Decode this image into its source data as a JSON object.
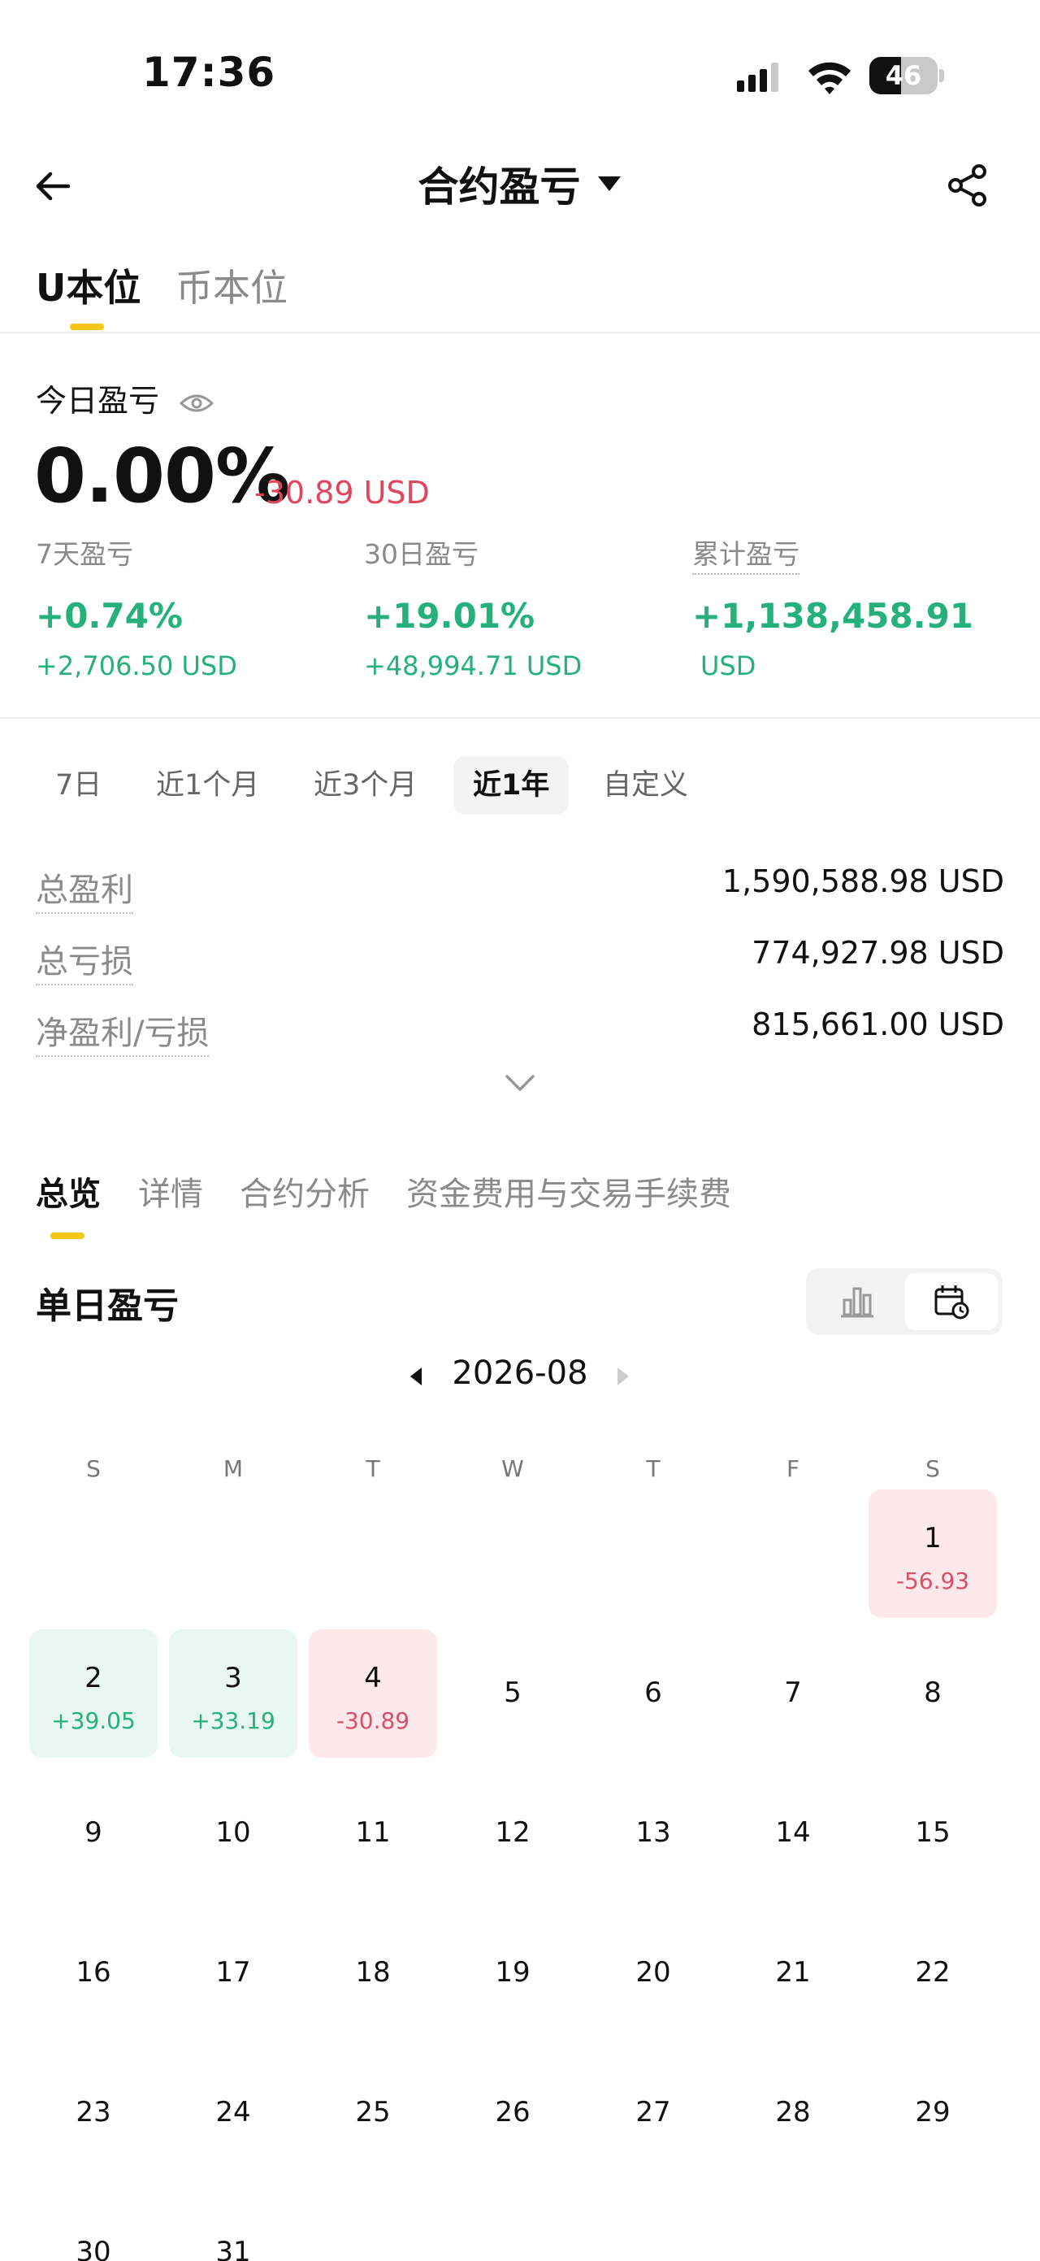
{
  "status_bar": {
    "time": "17:36",
    "battery": "46",
    "battery_level": 0.46
  },
  "header": {
    "title": "合约盈亏",
    "back_icon": "arrow-left-icon",
    "share_icon": "share-icon"
  },
  "unit_tabs": [
    {
      "label": "U本位",
      "active": true
    },
    {
      "label": "币本位",
      "active": false
    }
  ],
  "today": {
    "label": "今日盈亏",
    "percent": "0.00%",
    "usd": "-30.89 USD"
  },
  "stats": [
    {
      "label": "7天盈亏",
      "pct": "+0.74%",
      "usd": "+2,706.50 USD"
    },
    {
      "label": "30日盈亏",
      "pct": "+19.01%",
      "usd": "+48,994.71 USD"
    },
    {
      "label": "累计盈亏",
      "pct": "+1,138,458.91",
      "usd": "USD"
    }
  ],
  "ranges": [
    {
      "label": "7日",
      "active": false
    },
    {
      "label": "近1个月",
      "active": false
    },
    {
      "label": "近3个月",
      "active": false
    },
    {
      "label": "近1年",
      "active": true
    },
    {
      "label": "自定义",
      "active": false
    }
  ],
  "totals": [
    {
      "label": "总盈利",
      "value": "1,590,588.98 USD"
    },
    {
      "label": "总亏损",
      "value": "774,927.98 USD"
    },
    {
      "label": "净盈利/亏损",
      "value": "815,661.00 USD"
    }
  ],
  "section_tabs": [
    {
      "label": "总览",
      "active": true
    },
    {
      "label": "详情",
      "active": false
    },
    {
      "label": "合约分析",
      "active": false
    },
    {
      "label": "资金费用与交易手续费",
      "active": false
    }
  ],
  "daily": {
    "title": "单日盈亏",
    "month": "2026-08",
    "weekdays": [
      "S",
      "M",
      "T",
      "W",
      "T",
      "F",
      "S"
    ],
    "days": [
      {
        "d": "1",
        "pnl": "-56.93",
        "type": "loss"
      },
      {
        "d": "2",
        "pnl": "+39.05",
        "type": "profit"
      },
      {
        "d": "3",
        "pnl": "+33.19",
        "type": "profit"
      },
      {
        "d": "4",
        "pnl": "-30.89",
        "type": "loss"
      },
      {
        "d": "5"
      },
      {
        "d": "6"
      },
      {
        "d": "7"
      },
      {
        "d": "8"
      },
      {
        "d": "9"
      },
      {
        "d": "10"
      },
      {
        "d": "11"
      },
      {
        "d": "12"
      },
      {
        "d": "13"
      },
      {
        "d": "14"
      },
      {
        "d": "15"
      },
      {
        "d": "16"
      },
      {
        "d": "17"
      },
      {
        "d": "18"
      },
      {
        "d": "19"
      },
      {
        "d": "20"
      },
      {
        "d": "21"
      },
      {
        "d": "22"
      },
      {
        "d": "23"
      },
      {
        "d": "24"
      },
      {
        "d": "25"
      },
      {
        "d": "26"
      },
      {
        "d": "27"
      },
      {
        "d": "28"
      },
      {
        "d": "29"
      },
      {
        "d": "30"
      },
      {
        "d": "31"
      }
    ]
  },
  "colors": {
    "profit": "#26b07c",
    "loss": "#e0465e",
    "accent": "#f5c518"
  }
}
